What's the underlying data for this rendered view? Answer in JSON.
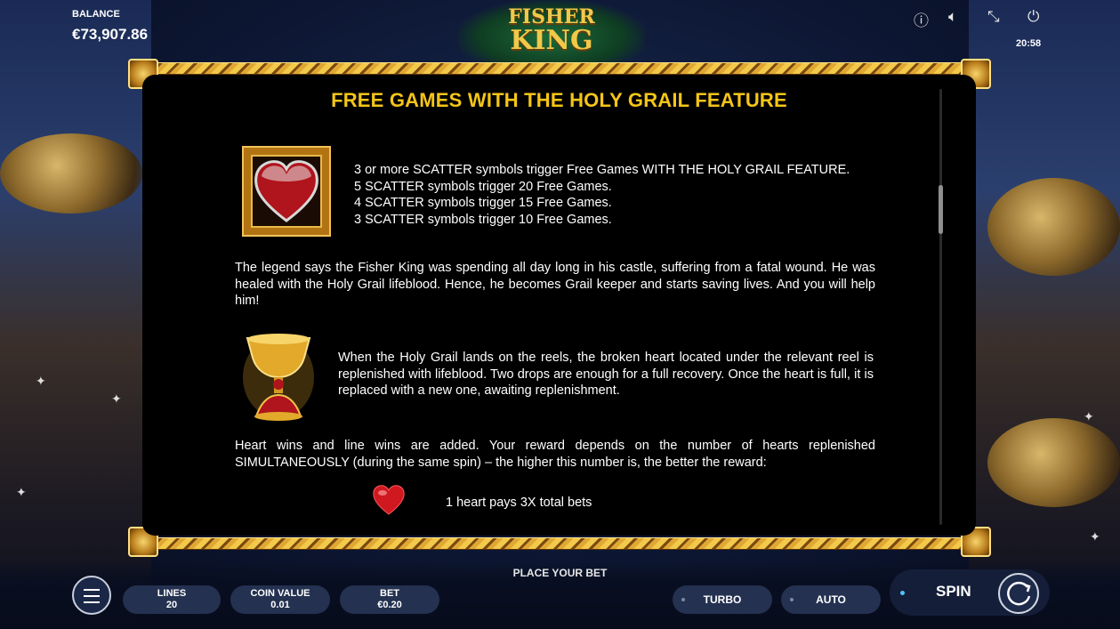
{
  "header": {
    "balance_label": "BALANCE",
    "balance_value": "€73,907.86",
    "logo_top": "FISHER",
    "logo_bottom": "KING",
    "time": "20:58",
    "icons": [
      "info-icon",
      "sound-off-icon",
      "fullscreen-icon",
      "power-icon"
    ]
  },
  "panel": {
    "title": "FREE GAMES WITH THE HOLY GRAIL FEATURE",
    "scatter_lines": [
      "3 or more SCATTER symbols trigger Free Games WITH THE HOLY GRAIL FEATURE.",
      "5 SCATTER symbols trigger 20 Free Games.",
      "4 SCATTER symbols trigger 15 Free Games.",
      "3 SCATTER symbols trigger 10 Free Games."
    ],
    "legend_text": "The legend says the Fisher King was spending all day long in his castle, suffering from a fatal wound. He was healed with the Holy Grail lifeblood. Hence, he becomes Grail keeper and starts saving lives. And you will help him!",
    "grail_text": "When the Holy Grail lands on the reels, the broken heart located under the relevant reel is replenished with lifeblood. Two drops are enough for a full recovery. Once the heart is full, it is replaced with a new one, awaiting replenishment.",
    "wins_text": "Heart wins and line wins are added. Your reward depends on the number of hearts replenished SIMULTANEOUSLY (during the same spin) – the higher this number is, the better the reward:",
    "heart_pay": "1 heart pays 3X total bets"
  },
  "footer": {
    "place_bet": "PLACE YOUR BET",
    "lines_label": "LINES",
    "lines_value": "20",
    "coin_label": "COIN VALUE",
    "coin_value": "0.01",
    "bet_label": "BET",
    "bet_value": "€0.20",
    "turbo": "TURBO",
    "auto": "AUTO",
    "spin": "SPIN"
  },
  "colors": {
    "title_gold": "#f5c518",
    "frame_gold": "#f2c94a",
    "panel_bg": "#000000",
    "pill_bg": "#243150"
  }
}
